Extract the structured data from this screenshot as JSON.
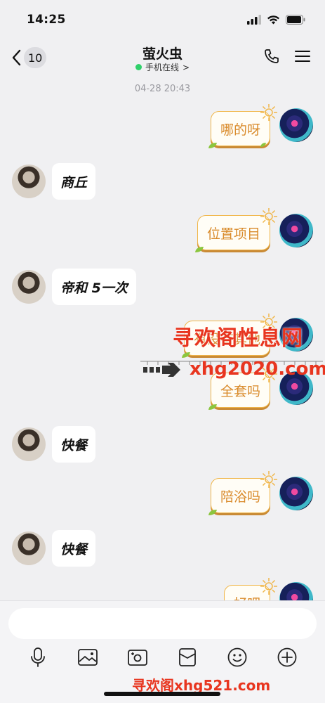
{
  "status_bar": {
    "time": "14:25"
  },
  "header": {
    "back_count": "10",
    "title": "萤火虫",
    "subtitle": "手机在线",
    "subtitle_arrow": ">",
    "online_color": "#2fd06a"
  },
  "chat": {
    "timestamp": "04-28 20:43",
    "messages": [
      {
        "side": "right",
        "text": "哪的呀"
      },
      {
        "side": "left",
        "text": "商丘"
      },
      {
        "side": "right",
        "text": "位置项目"
      },
      {
        "side": "left",
        "text": "帝和 5一次"
      },
      {
        "side": "right",
        "text": "有没有其他"
      },
      {
        "side": "right",
        "text": "全套吗"
      },
      {
        "side": "left",
        "text": "快餐"
      },
      {
        "side": "right",
        "text": "陪浴吗"
      },
      {
        "side": "left",
        "text": "快餐"
      },
      {
        "side": "right",
        "text": "好吧"
      }
    ]
  },
  "watermarks": {
    "top": "寻欢阁性息网",
    "middle": "xhg2020.com",
    "bottom": "寻欢阁xhg521.com"
  },
  "input": {
    "placeholder": ""
  },
  "toolbar": {
    "icons": [
      "microphone-icon",
      "image-icon",
      "camera-icon",
      "red-packet-icon",
      "emoji-icon",
      "plus-icon"
    ]
  },
  "colors": {
    "bubble_self_border": "#f0b64a",
    "bubble_self_text": "#d98a2a",
    "watermark": "#e8351f"
  }
}
